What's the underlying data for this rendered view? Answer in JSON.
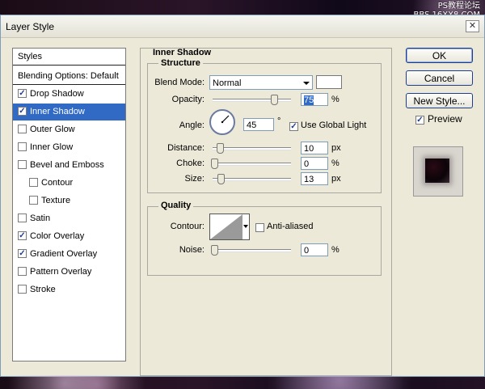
{
  "watermark": {
    "line1": "PS教程论坛",
    "line2": "BBS.16XX8.COM"
  },
  "dialog": {
    "title": "Layer Style",
    "close_glyph": "✕"
  },
  "styles_panel": {
    "header": "Styles",
    "blending": "Blending Options: Default",
    "items": [
      {
        "label": "Drop Shadow",
        "checked": true,
        "selected": false
      },
      {
        "label": "Inner Shadow",
        "checked": true,
        "selected": true
      },
      {
        "label": "Outer Glow",
        "checked": false,
        "selected": false
      },
      {
        "label": "Inner Glow",
        "checked": false,
        "selected": false
      },
      {
        "label": "Bevel and Emboss",
        "checked": false,
        "selected": false
      },
      {
        "label": "Contour",
        "checked": false,
        "selected": false
      },
      {
        "label": "Texture",
        "checked": false,
        "selected": false
      },
      {
        "label": "Satin",
        "checked": false,
        "selected": false
      },
      {
        "label": "Color Overlay",
        "checked": true,
        "selected": false
      },
      {
        "label": "Gradient Overlay",
        "checked": true,
        "selected": false
      },
      {
        "label": "Pattern Overlay",
        "checked": false,
        "selected": false
      },
      {
        "label": "Stroke",
        "checked": false,
        "selected": false
      }
    ]
  },
  "inner_shadow": {
    "title": "Inner Shadow",
    "structure": {
      "title": "Structure",
      "blend_mode_label": "Blend Mode:",
      "blend_mode_value": "Normal",
      "shadow_color": "#ffffff",
      "opacity_label": "Opacity:",
      "opacity_value": "75",
      "opacity_unit": "%",
      "angle_label": "Angle:",
      "angle_value": "45",
      "angle_unit": "°",
      "use_global_light_label": "Use Global Light",
      "use_global_light": true,
      "distance_label": "Distance:",
      "distance_value": "10",
      "distance_unit": "px",
      "choke_label": "Choke:",
      "choke_value": "0",
      "choke_unit": "%",
      "size_label": "Size:",
      "size_value": "13",
      "size_unit": "px"
    },
    "quality": {
      "title": "Quality",
      "contour_label": "Contour:",
      "anti_aliased_label": "Anti-aliased",
      "anti_aliased": false,
      "noise_label": "Noise:",
      "noise_value": "0",
      "noise_unit": "%"
    }
  },
  "buttons": {
    "ok": "OK",
    "cancel": "Cancel",
    "new_style": "New Style...",
    "preview_label": "Preview",
    "preview_checked": true
  },
  "checkmark": "✓"
}
